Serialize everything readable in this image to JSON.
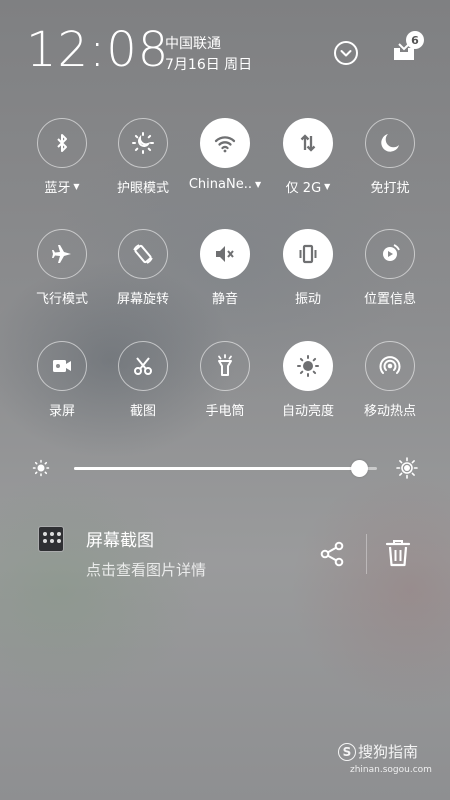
{
  "status": {
    "time": "12:08",
    "carrier": "中国联通",
    "date": "7月16日 周日",
    "notification_count": "6"
  },
  "tiles": [
    {
      "label": "蓝牙",
      "icon": "bluetooth-icon",
      "active": false,
      "has_menu": true
    },
    {
      "label": "护眼模式",
      "icon": "eye-care-icon",
      "active": false,
      "has_menu": false
    },
    {
      "label": "ChinaNe..",
      "icon": "wifi-icon",
      "active": true,
      "has_menu": true
    },
    {
      "label": "仅 2G",
      "icon": "mobile-data-icon",
      "active": true,
      "has_menu": true
    },
    {
      "label": "免打扰",
      "icon": "moon-icon",
      "active": false,
      "has_menu": false
    },
    {
      "label": "飞行模式",
      "icon": "airplane-icon",
      "active": false,
      "has_menu": false
    },
    {
      "label": "屏幕旋转",
      "icon": "rotate-icon",
      "active": false,
      "has_menu": false
    },
    {
      "label": "静音",
      "icon": "mute-icon",
      "active": true,
      "has_menu": false
    },
    {
      "label": "振动",
      "icon": "vibrate-icon",
      "active": true,
      "has_menu": false
    },
    {
      "label": "位置信息",
      "icon": "location-icon",
      "active": false,
      "has_menu": false
    },
    {
      "label": "录屏",
      "icon": "screen-record-icon",
      "active": false,
      "has_menu": false
    },
    {
      "label": "截图",
      "icon": "scissors-icon",
      "active": false,
      "has_menu": false
    },
    {
      "label": "手电筒",
      "icon": "flashlight-icon",
      "active": false,
      "has_menu": false
    },
    {
      "label": "自动亮度",
      "icon": "auto-brightness-icon",
      "active": true,
      "has_menu": false
    },
    {
      "label": "移动热点",
      "icon": "hotspot-icon",
      "active": false,
      "has_menu": false
    }
  ],
  "brightness": {
    "level": 0.94
  },
  "notification": {
    "title": "屏幕截图",
    "subtitle": "点击查看图片详情"
  },
  "watermark": {
    "logo_letter": "S",
    "brand": "搜狗指南",
    "url": "zhinan.sogou.com"
  },
  "colors": {
    "active_tile": "#ffffff",
    "active_glyph": "#6f7072"
  }
}
